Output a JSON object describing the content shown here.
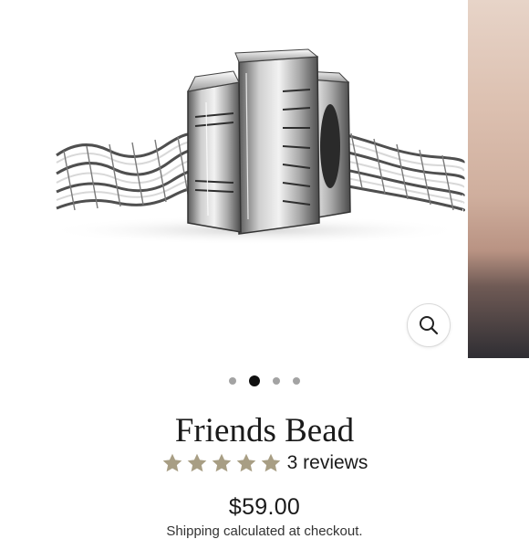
{
  "product": {
    "title": "Friends Bead",
    "rating": 5,
    "reviews_label": "3 reviews",
    "price": "$59.00",
    "shipping_note": "Shipping calculated at checkout."
  },
  "gallery": {
    "total_images": 4,
    "active_index": 2,
    "zoom_icon": "magnifier-icon"
  },
  "colors": {
    "star": "#a89e84",
    "text": "#1a1a1a",
    "active_dot": "#111111",
    "inactive_dot": "#a3a3a3"
  }
}
